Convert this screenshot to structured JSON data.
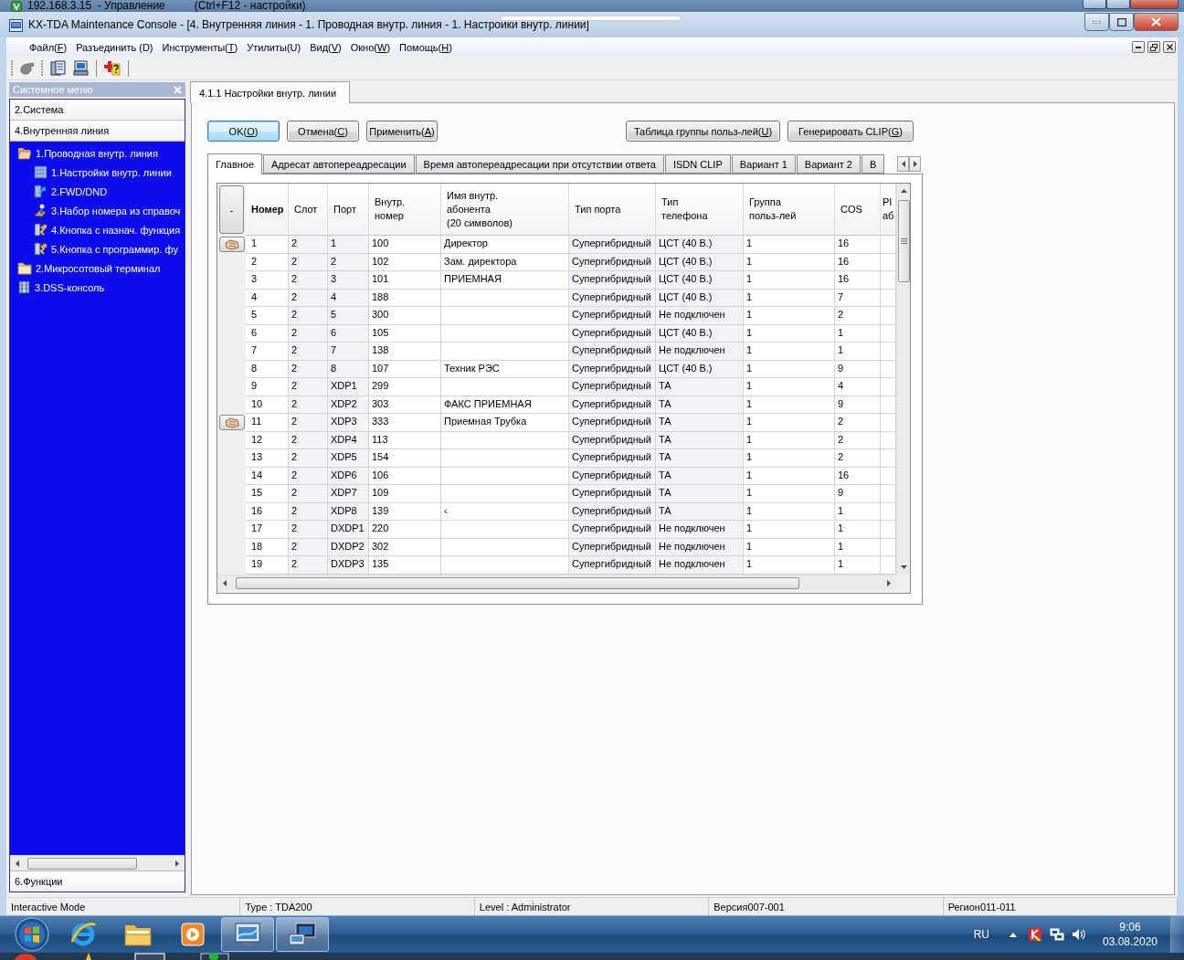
{
  "remote_bar": {
    "host": "192.168.3.15  - Управление",
    "hint": "(Ctrl+F12 - настройки)"
  },
  "window": {
    "title": "KX-TDA Maintenance Console - [4. Внутренняя линия - 1. Проводная внутр. линия - 1. Настройки внутр. линии]"
  },
  "menu": [
    {
      "text": "Файл(",
      "accel": "F",
      "after": ")"
    },
    {
      "text": "Разъединить (D)"
    },
    {
      "text": "Инструменты(",
      "accel": "T",
      "after": ")"
    },
    {
      "text": "Утилиты(U)"
    },
    {
      "text": "Вид(",
      "accel": "V",
      "after": ")"
    },
    {
      "text": "Окно(",
      "accel": "W",
      "after": ")"
    },
    {
      "text": "Помощь(",
      "accel": "H",
      "after": ")"
    }
  ],
  "sidebar": {
    "title": "Системное меню",
    "sections_top": [
      "2.Система",
      "4.Внутренняя линия"
    ],
    "tree": [
      {
        "label": "1.Проводная внутр. линия",
        "kind": "folder",
        "expanded": true,
        "children": [
          {
            "label": "1.Настройки внутр. линии",
            "kind": "settings"
          },
          {
            "label": "2.FWD/DND",
            "kind": "forward"
          },
          {
            "label": "3.Набор номера из справоч",
            "kind": "dial"
          },
          {
            "label": "4.Кнопка с назнач. функция",
            "kind": "keys"
          },
          {
            "label": "5.Кнопка с программир. фу",
            "kind": "keys"
          }
        ]
      },
      {
        "label": "2.Микросотовый терминал",
        "kind": "folder",
        "expanded": false
      },
      {
        "label": "3.DSS-консоль",
        "kind": "console"
      }
    ],
    "sections_bottom": [
      "6.Функции"
    ]
  },
  "document_tabs": [
    {
      "label": "4.1.1 Настройки внутр. линии",
      "selected": true
    }
  ],
  "buttons_left": [
    {
      "text": "OK(",
      "accel": "O",
      "after": ")",
      "default": true
    },
    {
      "text": "Отмена(",
      "accel": "C",
      "after": ")",
      "default": false
    },
    {
      "text": "Применить(",
      "accel": "A",
      "after": ")",
      "default": false
    }
  ],
  "buttons_right": [
    {
      "text": "Таблица группы польз-лей(",
      "accel": "U",
      "after": ")"
    },
    {
      "text": "Генерировать CLIP(",
      "accel": "G",
      "after": ")"
    }
  ],
  "tabs": [
    {
      "label": "Главное",
      "selected": true
    },
    {
      "label": "Адресат автопереадресации",
      "selected": false
    },
    {
      "label": "Время автопереадресации при отсутствии ответа",
      "selected": false
    },
    {
      "label": "ISDN CLIP",
      "selected": false
    },
    {
      "label": "Вариант 1",
      "selected": false
    },
    {
      "label": "Вариант 2",
      "selected": false
    },
    {
      "label": "В",
      "selected": false
    }
  ],
  "table": {
    "corner": "-",
    "columns": [
      {
        "label": "Номер",
        "sorted": true,
        "readonly": false
      },
      {
        "label": "Слот",
        "sorted": false,
        "readonly": true
      },
      {
        "label": "Порт",
        "sorted": false,
        "readonly": true
      },
      {
        "label": "Внутр.\nномер",
        "sorted": false,
        "readonly": false
      },
      {
        "label": "Имя внутр.\nабонента\n(20 символов)",
        "sorted": false,
        "readonly": false
      },
      {
        "label": "Тип порта",
        "sorted": false,
        "readonly": true
      },
      {
        "label": "Тип\nтелефона",
        "sorted": false,
        "readonly": true
      },
      {
        "label": "Группа\nпольз-лей",
        "sorted": false,
        "readonly": false
      },
      {
        "label": "COS",
        "sorted": false,
        "readonly": false
      },
      {
        "label": "PI\nаб",
        "sorted": false,
        "readonly": false
      }
    ],
    "rows": [
      {
        "button": true,
        "number": "1",
        "slot": "2",
        "port": "1",
        "ext": "100",
        "name": "Директор",
        "port_type": "Супергибридный",
        "phone_type": "ЦСТ (40 В.)",
        "group": "1",
        "cos": "16"
      },
      {
        "button": false,
        "number": "2",
        "slot": "2",
        "port": "2",
        "ext": "102",
        "name": "Зам. директора",
        "port_type": "Супергибридный",
        "phone_type": "ЦСТ (40 В.)",
        "group": "1",
        "cos": "16"
      },
      {
        "button": false,
        "number": "3",
        "slot": "2",
        "port": "3",
        "ext": "101",
        "name": "ПРИЕМНАЯ",
        "port_type": "Супергибридный",
        "phone_type": "ЦСТ (40 В.)",
        "group": "1",
        "cos": "16"
      },
      {
        "button": false,
        "number": "4",
        "slot": "2",
        "port": "4",
        "ext": "188",
        "port_type": "Супергибридный",
        "phone_type": "ЦСТ (40 В.)",
        "group": "1",
        "cos": "7"
      },
      {
        "button": false,
        "number": "5",
        "slot": "2",
        "port": "5",
        "ext": "300",
        "port_type": "Супергибридный",
        "phone_type": "Не подключен",
        "group": "1",
        "cos": "2"
      },
      {
        "button": false,
        "number": "6",
        "slot": "2",
        "port": "6",
        "ext": "105",
        "port_type": "Супергибридный",
        "phone_type": "ЦСТ (40 В.)",
        "group": "1",
        "cos": "1"
      },
      {
        "button": false,
        "number": "7",
        "slot": "2",
        "port": "7",
        "ext": "138",
        "port_type": "Супергибридный",
        "phone_type": "Не подключен",
        "group": "1",
        "cos": "1"
      },
      {
        "button": false,
        "number": "8",
        "slot": "2",
        "port": "8",
        "ext": "107",
        "name": "Техник РЭС",
        "port_type": "Супергибридный",
        "phone_type": "ЦСТ (40 В.)",
        "group": "1",
        "cos": "9"
      },
      {
        "button": false,
        "number": "9",
        "slot": "2",
        "port": "XDP1",
        "ext": "299",
        "port_type": "Супергибридный",
        "phone_type": "ТА",
        "group": "1",
        "cos": "4"
      },
      {
        "button": false,
        "number": "10",
        "slot": "2",
        "port": "XDP2",
        "ext": "303",
        "name": "ФАКС ПРИЕМНАЯ",
        "port_type": "Супергибридный",
        "phone_type": "ТА",
        "group": "1",
        "cos": "9"
      },
      {
        "button": true,
        "number": "11",
        "slot": "2",
        "port": "XDP3",
        "ext": "333",
        "name": "Приемная Трубка",
        "port_type": "Супергибридный",
        "phone_type": "ТА",
        "group": "1",
        "cos": "2"
      },
      {
        "button": false,
        "number": "12",
        "slot": "2",
        "port": "XDP4",
        "ext": "113",
        "port_type": "Супергибридный",
        "phone_type": "ТА",
        "group": "1",
        "cos": "2"
      },
      {
        "button": false,
        "number": "13",
        "slot": "2",
        "port": "XDP5",
        "ext": "154",
        "port_type": "Супергибридный",
        "phone_type": "ТА",
        "group": "1",
        "cos": "2"
      },
      {
        "button": false,
        "number": "14",
        "slot": "2",
        "port": "XDP6",
        "ext": "106",
        "port_type": "Супергибридный",
        "phone_type": "ТА",
        "group": "1",
        "cos": "16"
      },
      {
        "button": false,
        "number": "15",
        "slot": "2",
        "port": "XDP7",
        "ext": "109",
        "port_type": "Супергибридный",
        "phone_type": "ТА",
        "group": "1",
        "cos": "9"
      },
      {
        "button": false,
        "number": "16",
        "slot": "2",
        "port": "XDP8",
        "ext": "139",
        "name": "‹",
        "port_type": "Супергибридный",
        "phone_type": "ТА",
        "group": "1",
        "cos": "1"
      },
      {
        "button": false,
        "number": "17",
        "slot": "2",
        "port": "DXDP1",
        "ext": "220",
        "port_type": "Супергибридный",
        "phone_type": "Не подключен",
        "group": "1",
        "cos": "1"
      },
      {
        "button": false,
        "number": "18",
        "slot": "2",
        "port": "DXDP2",
        "ext": "302",
        "port_type": "Супергибридный",
        "phone_type": "Не подключен",
        "group": "1",
        "cos": "1"
      },
      {
        "button": false,
        "number": "19",
        "slot": "2",
        "port": "DXDP3",
        "ext": "135",
        "port_type": "Супергибридный",
        "phone_type": "Не подключен",
        "group": "1",
        "cos": "1"
      }
    ]
  },
  "status_bar": [
    "Interactive Mode",
    "Type : TDA200",
    "Level : Administrator",
    "Версия007-001",
    "Регион011-011"
  ],
  "taskbar": {
    "apps": [
      {
        "kind": "browser",
        "running": false
      },
      {
        "kind": "folder",
        "running": false
      },
      {
        "kind": "media",
        "running": false
      },
      {
        "kind": "console",
        "running": true
      },
      {
        "kind": "remote",
        "running": true
      }
    ],
    "language": "RU",
    "time": "9:06",
    "date": "03.08.2020"
  }
}
